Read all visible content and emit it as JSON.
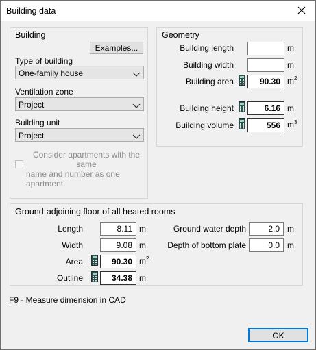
{
  "window": {
    "title": "Building data",
    "close_glyph": "✕"
  },
  "building": {
    "title": "Building",
    "examples_label": "Examples...",
    "type_label": "Type of building",
    "type_value": "One-family house",
    "vent_label": "Ventilation zone",
    "vent_value": "Project",
    "unit_label": "Building unit",
    "unit_value": "Project",
    "consider_lines": [
      "Consider apartments with the same",
      "name and number as one",
      "apartment"
    ],
    "consider_checked": false
  },
  "geometry": {
    "title": "Geometry",
    "length": {
      "label": "Building length",
      "value": "",
      "unit": "m"
    },
    "width": {
      "label": "Building width",
      "value": "",
      "unit": "m"
    },
    "area": {
      "label": "Building area",
      "value": "90.30",
      "unit": "m",
      "unit_sup": "2"
    },
    "height": {
      "label": "Building height",
      "value": "6.16",
      "unit": "m"
    },
    "volume": {
      "label": "Building volume",
      "value": "556",
      "unit": "m",
      "unit_sup": "3"
    }
  },
  "ground": {
    "title": "Ground-adjoining floor of all heated rooms",
    "length": {
      "label": "Length",
      "value": "8.11",
      "unit": "m"
    },
    "width": {
      "label": "Width",
      "value": "9.08",
      "unit": "m"
    },
    "area": {
      "label": "Area",
      "value": "90.30",
      "unit": "m",
      "unit_sup": "2"
    },
    "outline": {
      "label": "Outline",
      "value": "34.38",
      "unit": "m"
    },
    "water_depth": {
      "label": "Ground water depth",
      "value": "2.0",
      "unit": "m"
    },
    "plate_depth": {
      "label": "Depth of bottom plate",
      "value": "0.0",
      "unit": "m"
    }
  },
  "hint": "F9 - Measure dimension in CAD",
  "ok_label": "OK",
  "icons": {
    "calculator": "calculator-icon",
    "chevron": "chevron-down-icon",
    "close": "close-icon"
  }
}
